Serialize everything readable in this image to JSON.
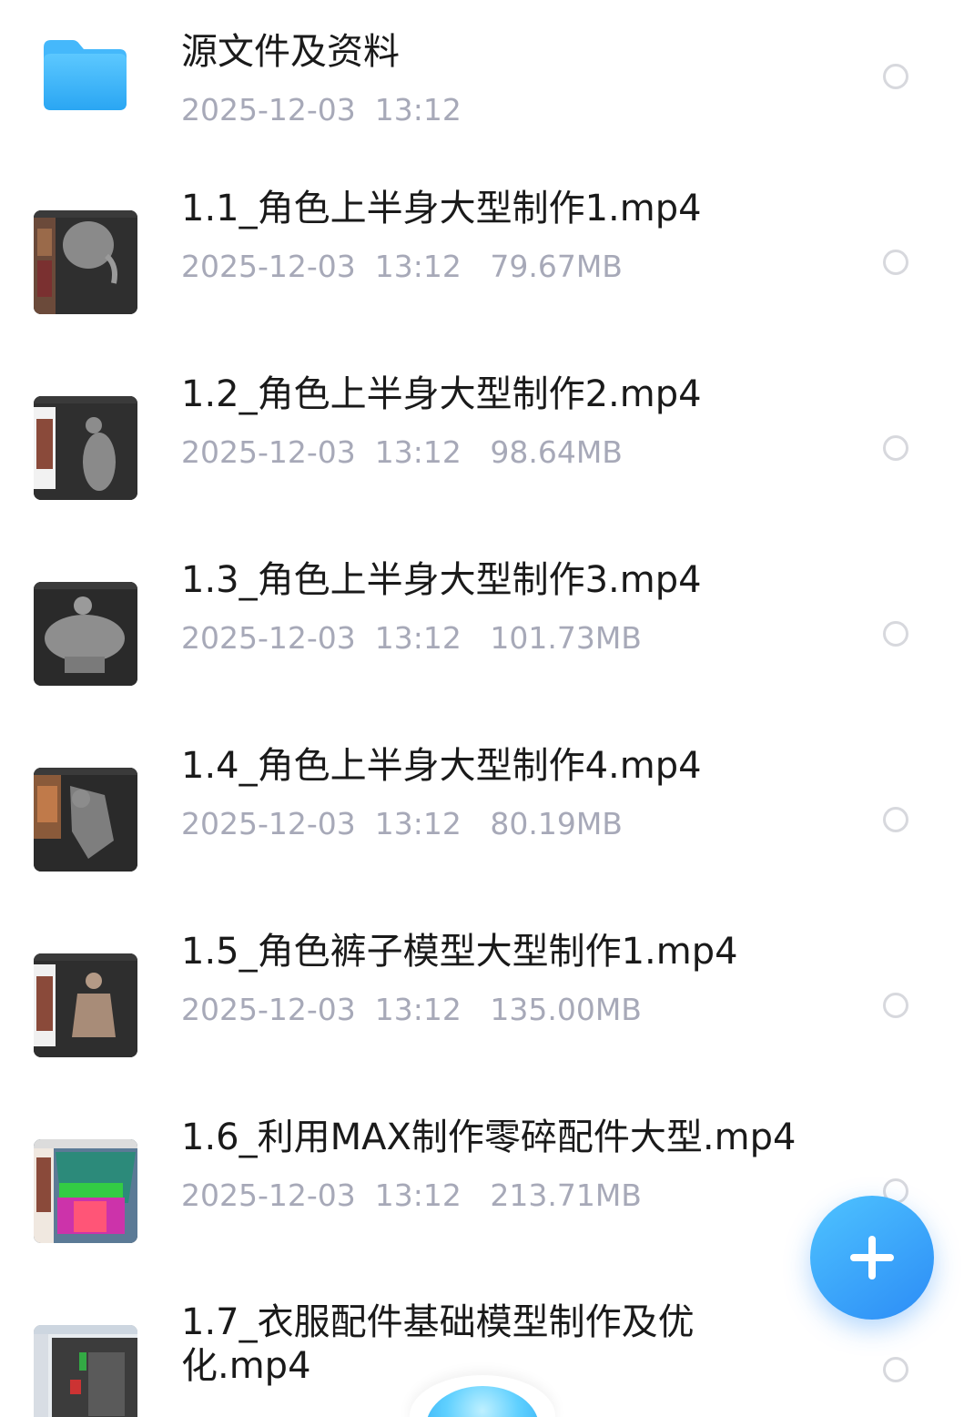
{
  "files": [
    {
      "type": "folder",
      "icon": "folder-icon",
      "name": "源文件及资料",
      "date": "2025-12-03",
      "time": "13:12",
      "size": ""
    },
    {
      "type": "video",
      "icon": "video-thumbnail",
      "name": "1.1_角色上半身大型制作1.mp4",
      "date": "2025-12-03",
      "time": "13:12",
      "size": "79.67MB"
    },
    {
      "type": "video",
      "icon": "video-thumbnail",
      "name": "1.2_角色上半身大型制作2.mp4",
      "date": "2025-12-03",
      "time": "13:12",
      "size": "98.64MB"
    },
    {
      "type": "video",
      "icon": "video-thumbnail",
      "name": "1.3_角色上半身大型制作3.mp4",
      "date": "2025-12-03",
      "time": "13:12",
      "size": "101.73MB"
    },
    {
      "type": "video",
      "icon": "video-thumbnail",
      "name": "1.4_角色上半身大型制作4.mp4",
      "date": "2025-12-03",
      "time": "13:12",
      "size": "80.19MB"
    },
    {
      "type": "video",
      "icon": "video-thumbnail",
      "name": "1.5_角色裤子模型大型制作1.mp4",
      "date": "2025-12-03",
      "time": "13:12",
      "size": "135.00MB"
    },
    {
      "type": "video",
      "icon": "video-thumbnail",
      "name": "1.6_利用MAX制作零碎配件大型.mp4",
      "date": "2025-12-03",
      "time": "13:12",
      "size": "213.71MB"
    },
    {
      "type": "video",
      "icon": "video-thumbnail",
      "name": "1.7_衣服配件基础模型制作及优化.mp4",
      "date": "",
      "time": "",
      "size": ""
    }
  ],
  "fab": {
    "icon": "plus-icon"
  },
  "colors": {
    "accent": "#2c8cf6",
    "folder": "#3cb4f8",
    "meta_text": "#a7a9b8",
    "name_text": "#1a1a1a"
  }
}
